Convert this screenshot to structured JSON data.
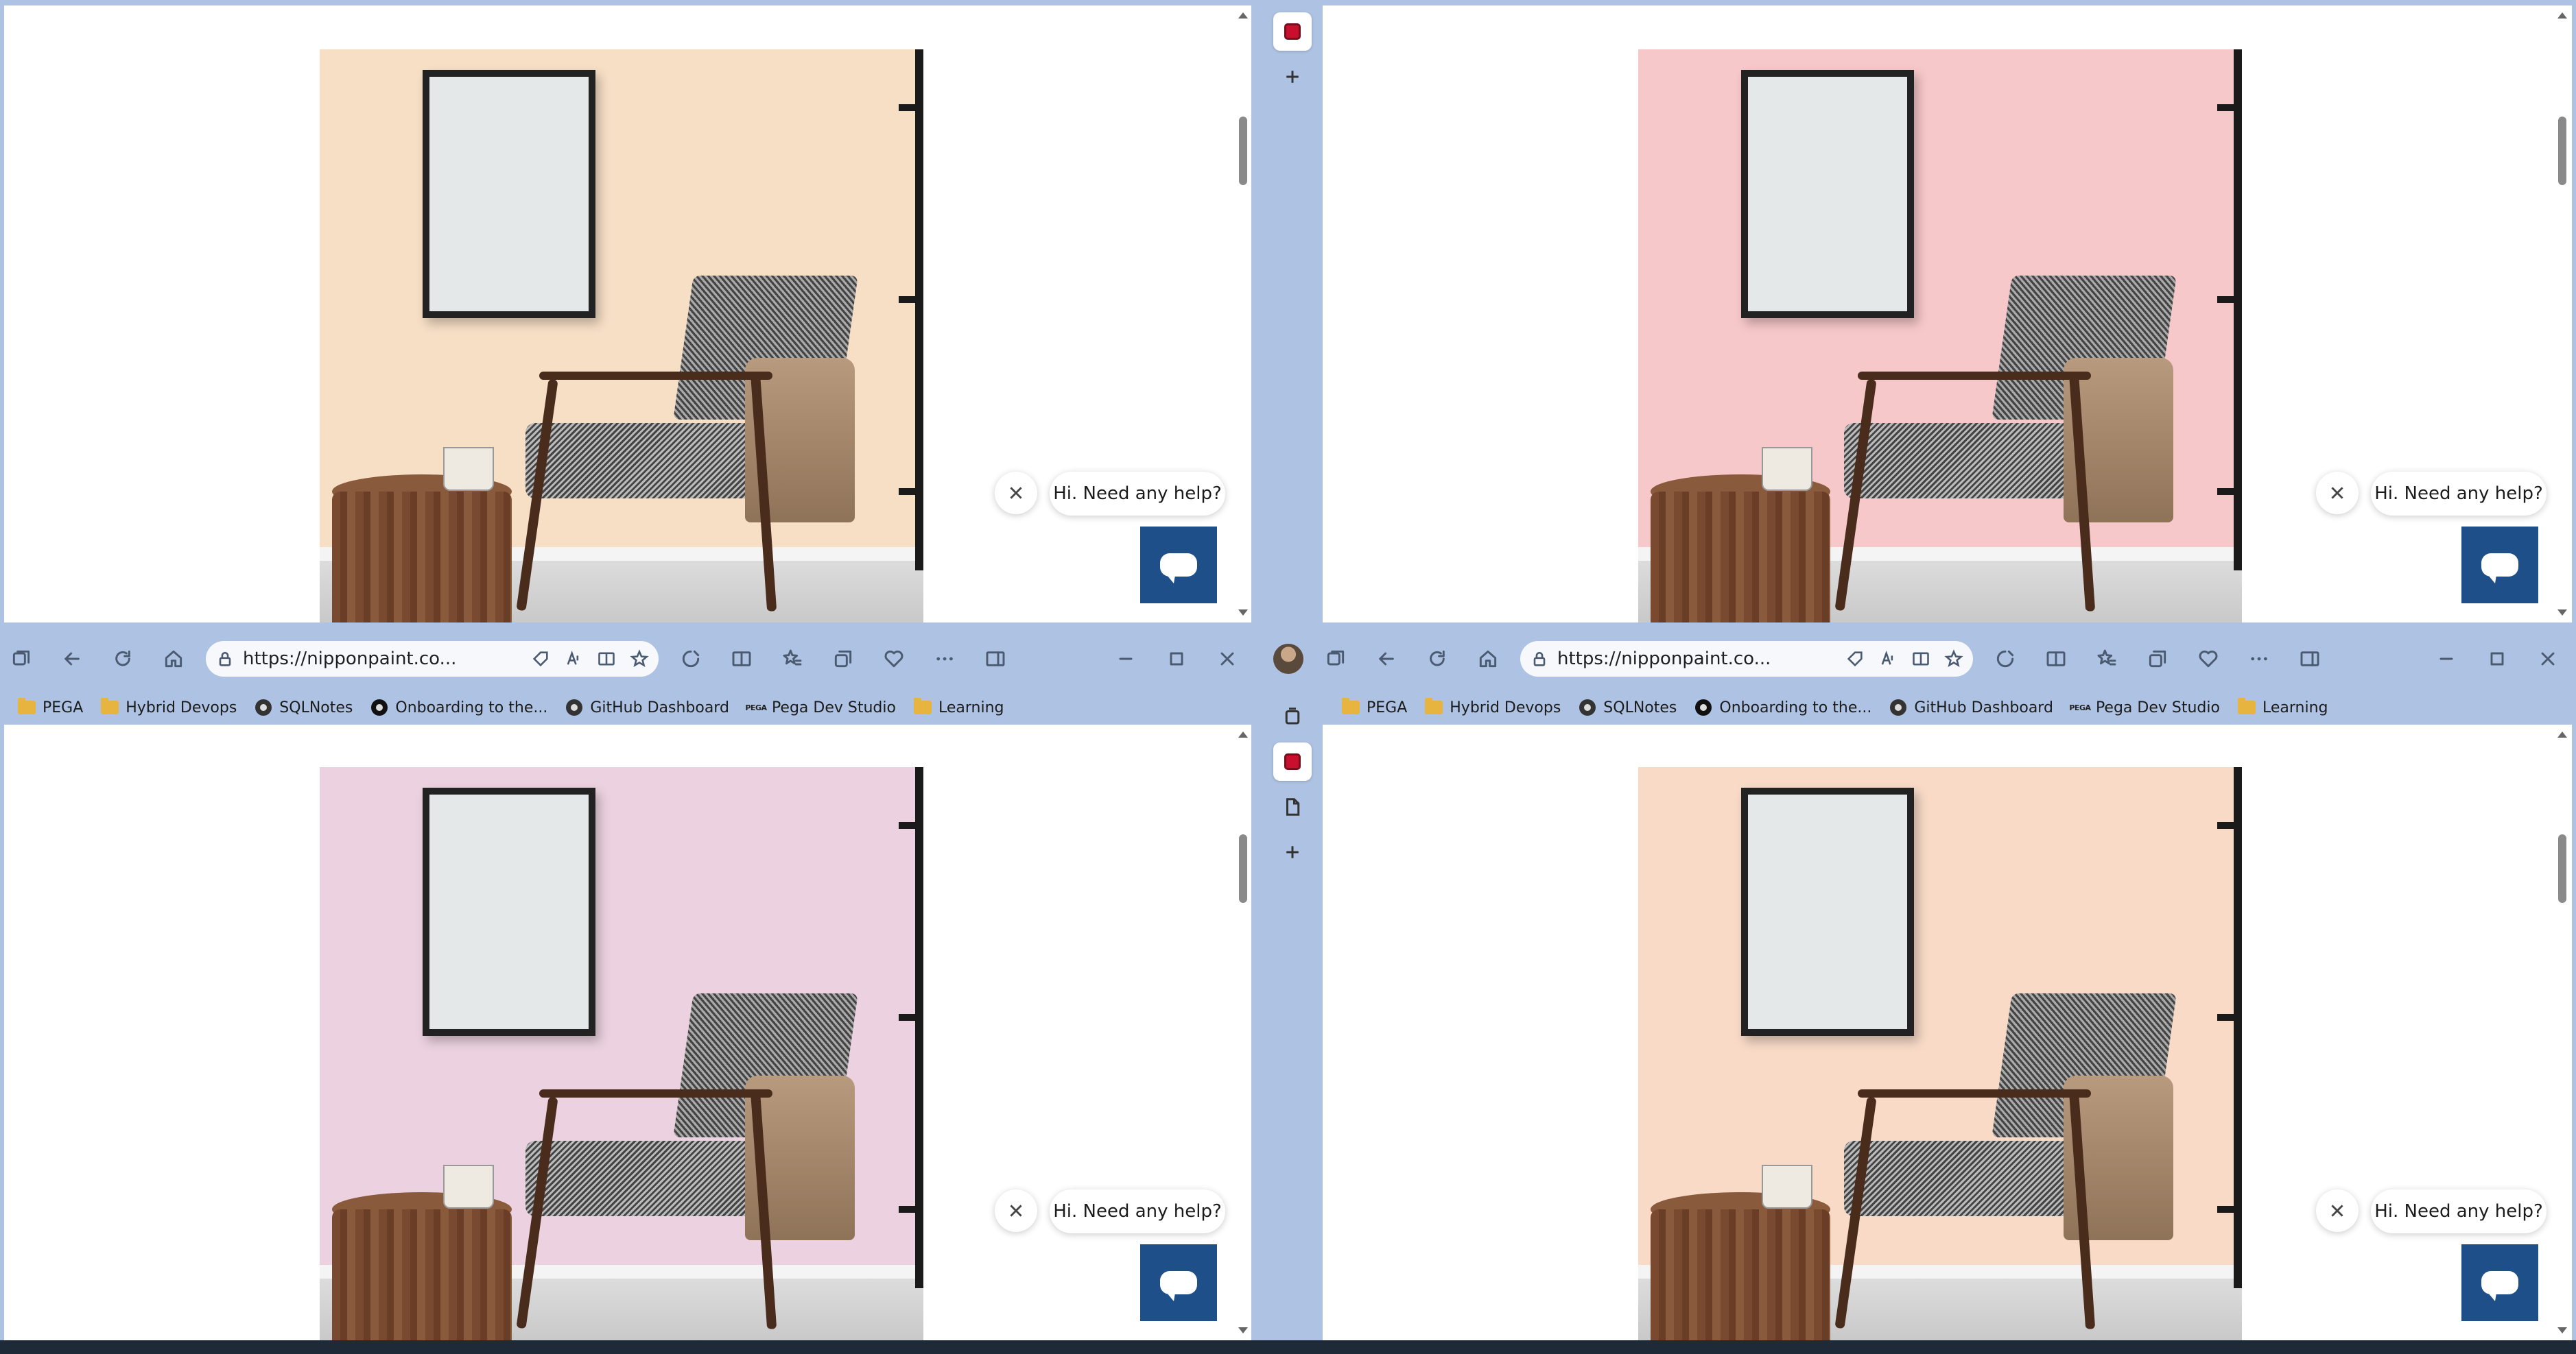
{
  "browser": {
    "url": "https://nipponpaint.co...",
    "favorites": [
      {
        "label": "PEGA",
        "icon": "folder-icon"
      },
      {
        "label": "Hybrid Devops",
        "icon": "folder-icon"
      },
      {
        "label": "SQLNotes",
        "icon": "github-icon"
      },
      {
        "label": "Onboarding to the...",
        "icon": "github-dark-icon"
      },
      {
        "label": "GitHub Dashboard",
        "icon": "github-icon"
      },
      {
        "label": "Pega Dev Studio",
        "icon": "pega-icon"
      },
      {
        "label": "Learning",
        "icon": "folder-icon"
      }
    ],
    "pega_badge": "PEGA"
  },
  "chat": {
    "greeting": "Hi. Need any help?"
  },
  "colors": {
    "wall_peach": "#f7dfc6",
    "wall_pink": "#f7c8c9",
    "wall_mauve": "#ecd2e0",
    "wall_apricot": "#f8dac7",
    "chat_button": "#1f4f89",
    "browser_chrome": "#aec3e3"
  }
}
